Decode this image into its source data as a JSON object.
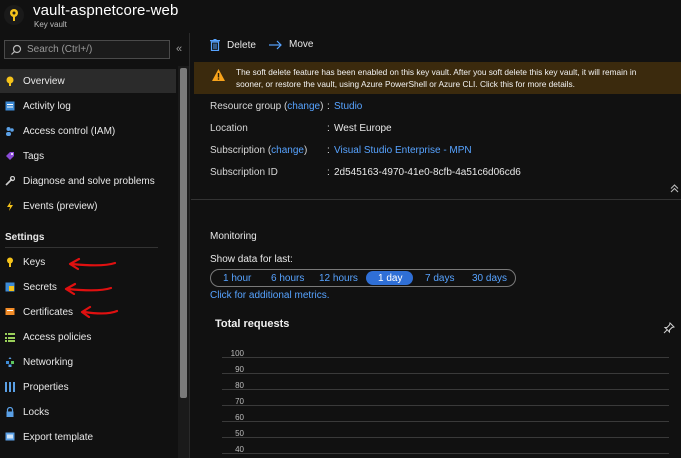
{
  "header": {
    "title": "vault-aspnetcore-web",
    "subtitle": "Key vault",
    "icon": "key-vault-icon"
  },
  "sidebar": {
    "search_placeholder": "Search (Ctrl+/)",
    "collapse_glyph": "«",
    "items": [
      {
        "label": "Overview",
        "icon": "overview-icon",
        "active": true
      },
      {
        "label": "Activity log",
        "icon": "activity-log-icon"
      },
      {
        "label": "Access control (IAM)",
        "icon": "access-control-icon"
      },
      {
        "label": "Tags",
        "icon": "tags-icon"
      },
      {
        "label": "Diagnose and solve problems",
        "icon": "wrench-icon"
      },
      {
        "label": "Events (preview)",
        "icon": "lightning-icon"
      }
    ],
    "settings_title": "Settings",
    "settings_items": [
      {
        "label": "Keys",
        "icon": "key-icon"
      },
      {
        "label": "Secrets",
        "icon": "secrets-icon"
      },
      {
        "label": "Certificates",
        "icon": "certificate-icon"
      },
      {
        "label": "Access policies",
        "icon": "access-policies-icon"
      },
      {
        "label": "Networking",
        "icon": "networking-icon"
      },
      {
        "label": "Properties",
        "icon": "properties-icon"
      },
      {
        "label": "Locks",
        "icon": "lock-icon"
      },
      {
        "label": "Export template",
        "icon": "export-template-icon"
      }
    ]
  },
  "toolbar": {
    "delete_label": "Delete",
    "move_label": "Move"
  },
  "banner": {
    "line1": "The soft delete feature has been enabled on this key vault. After you soft delete this key vault, it will remain in",
    "line2": "sooner, or restore the vault, using Azure PowerShell or Azure CLI. Click this for more details."
  },
  "essentials": {
    "resource_group_label": "Resource group",
    "resource_group_value": "Studio",
    "location_label": "Location",
    "location_value": "West Europe",
    "subscription_label": "Subscription",
    "subscription_value": "Visual Studio Enterprise - MPN",
    "subscription_id_label": "Subscription ID",
    "subscription_id_value": "2d545163-4970-41e0-8cfb-4a51c6d06cd6",
    "change_link": "change",
    "paren_open": "(",
    "paren_close": ")"
  },
  "monitoring": {
    "title": "Monitoring",
    "show_data_label": "Show data for last:",
    "ranges": [
      "1 hour",
      "6 hours",
      "12 hours",
      "1 day",
      "7 days",
      "30 days"
    ],
    "selected_range": "1 day",
    "more_metrics": "Click for additional metrics."
  },
  "chart_card": {
    "title": "Total requests",
    "y_ticks": [
      "100",
      "90",
      "80",
      "70",
      "60",
      "50",
      "40"
    ]
  },
  "colors": {
    "accent": "#57a3ff",
    "selected_pill": "#2f6fd6",
    "warning_bg": "#3b2a0d",
    "annotation_arrow": "#e01010"
  }
}
